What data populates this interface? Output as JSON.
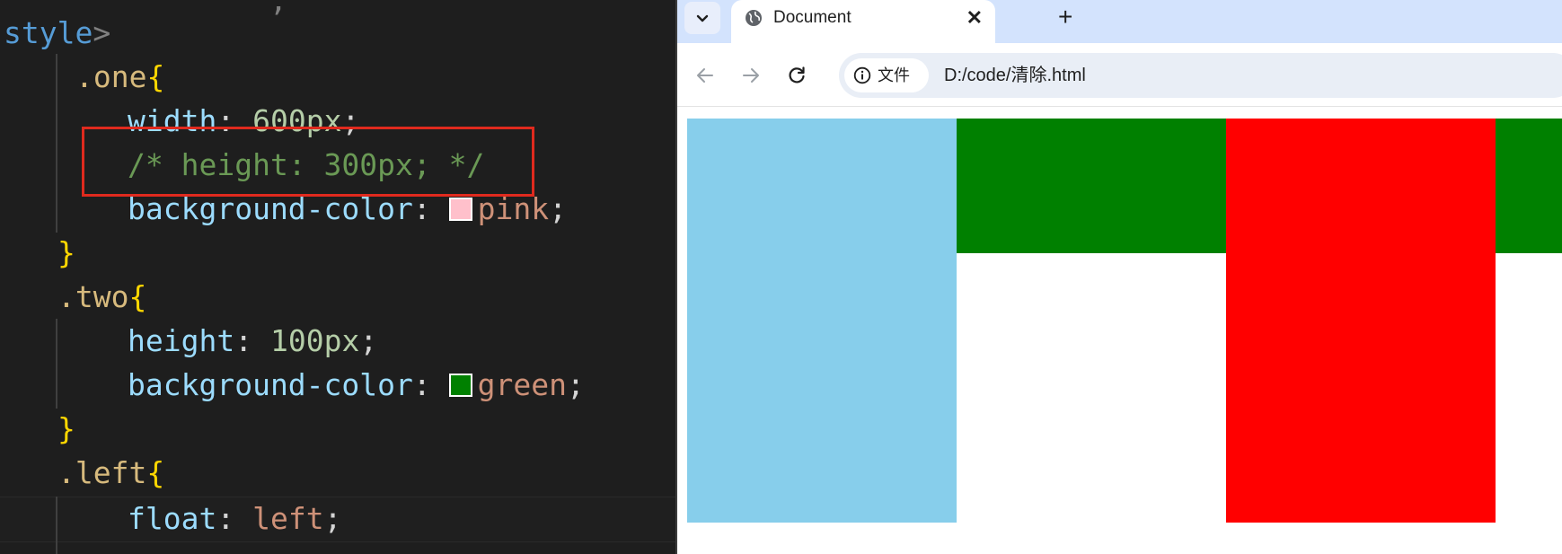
{
  "editor": {
    "line0": {
      "tag": "style",
      "bracket": ">"
    },
    "line1": {
      "selector": ".one",
      "brace": "{"
    },
    "line2": {
      "prop": "width",
      "colon": ": ",
      "number": "600px",
      "semi": ";"
    },
    "line3": {
      "comment": "/* height: 300px; */"
    },
    "line4": {
      "prop": "background-color",
      "colon": ": ",
      "value": "pink",
      "semi": ";",
      "swatch_color": "#ffc0cb"
    },
    "line5": {
      "brace": "}"
    },
    "line6": {
      "selector": ".two",
      "brace": "{"
    },
    "line7": {
      "prop": "height",
      "colon": ": ",
      "number": "100px",
      "semi": ";"
    },
    "line8": {
      "prop": "background-color",
      "colon": ": ",
      "value": "green",
      "semi": ";",
      "swatch_color": "#008000"
    },
    "line9": {
      "brace": "}"
    },
    "line10": {
      "selector": ".left",
      "brace": "{"
    },
    "line11": {
      "prop": "float",
      "colon": ": ",
      "value": "left",
      "semi": ";"
    },
    "highlight_color": "#e02a1e"
  },
  "browser": {
    "tab": {
      "title": "Document",
      "close": "✕",
      "favicon": "globe-icon"
    },
    "new_tab": "+",
    "tab_menu": "chevron-down-icon",
    "toolbar": {
      "back": "back-arrow-icon",
      "forward": "forward-arrow-icon",
      "reload": "reload-icon",
      "site_chip_label": "文件",
      "url": "D:/code/清除.html"
    },
    "page": {
      "colors": {
        "left": "#87ceeb",
        "two": "#008000",
        "red": "#ff0000"
      }
    }
  }
}
